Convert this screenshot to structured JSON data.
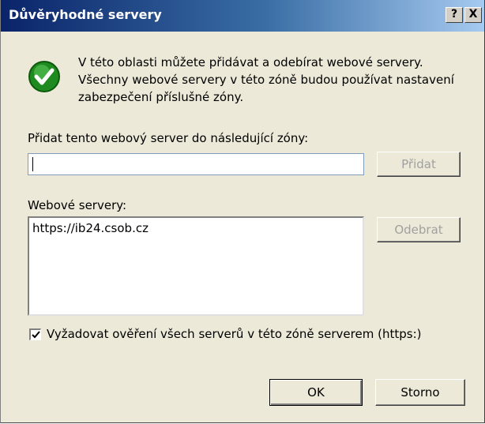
{
  "window": {
    "title": "Důvěryhodné servery",
    "help_label": "?",
    "close_label": "X"
  },
  "intro": {
    "icon": "check-circle-icon",
    "icon_color": "#2e8b2e",
    "lines": [
      "V této oblasti můžete přidávat a odebírat webové servery.",
      "Všechny webové servery v této zóně budou používat nastavení",
      "zabezpečení příslušné zóny."
    ]
  },
  "add": {
    "label": "Přidat tento webový server do následující zóny:",
    "input_value": "",
    "button_label": "Přidat"
  },
  "servers": {
    "label": "Webové servery:",
    "items": [
      "https://ib24.csob.cz"
    ],
    "remove_label": "Odebrat"
  },
  "require_https": {
    "label": "Vyžadovat ověření všech serverů v této zóně serverem (https:)",
    "checked": true
  },
  "footer": {
    "ok_label": "OK",
    "cancel_label": "Storno"
  }
}
